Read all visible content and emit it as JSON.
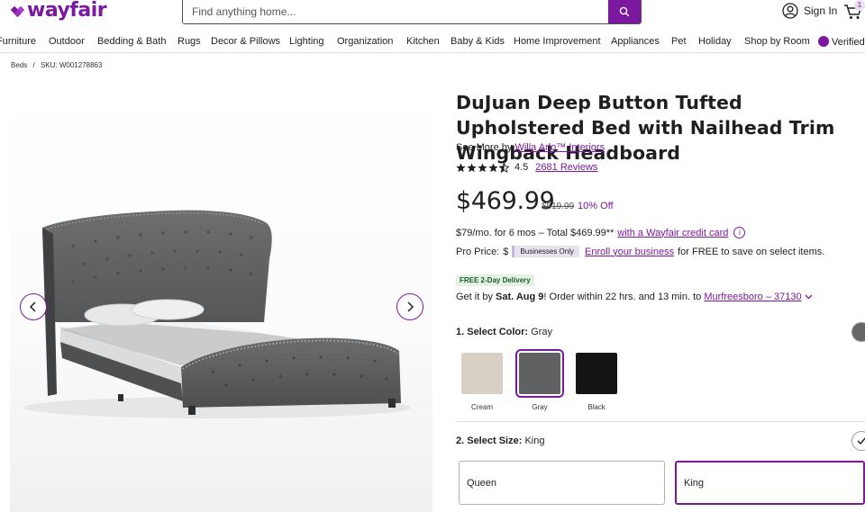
{
  "brand": {
    "name": "wayfair",
    "color": "#7b189f"
  },
  "search": {
    "placeholder": "Find anything home..."
  },
  "account": {
    "signin_label": "Sign In",
    "cart_count": "1"
  },
  "nav": [
    "Furniture",
    "Outdoor",
    "Bedding & Bath",
    "Rugs",
    "Decor & Pillows",
    "Lighting",
    "Organization",
    "Kitchen",
    "Baby & Kids",
    "Home Improvement",
    "Appliances",
    "Pet",
    "Holiday",
    "Shop by Room",
    "Verified"
  ],
  "breadcrumb": {
    "category": "Beds",
    "separator": "/",
    "sku": "SKU: W001278863"
  },
  "product": {
    "title": "DuJuan Deep Button Tufted Upholstered Bed with Nailhead Trim Wingback Headboard",
    "see_more_prefix": "See More by",
    "brand": "Willa Arlo™ Interiors",
    "rating": "4.5",
    "stars": 4.5,
    "reviews": "2681 Reviews",
    "price": "$469.99",
    "old_price": "$519.99",
    "discount": "10% Off",
    "finance_text": "$79/mo. for 6 mos – Total $469.99**",
    "finance_link": "with a Wayfair credit card",
    "pro_label": "Pro Price:",
    "pro_price": "$",
    "business_tag": "Businesses Only",
    "enroll_link": "Enroll your business",
    "enroll_suffix": "for FREE to save on select items.",
    "delivery_tag": "FREE 2-Day Delivery",
    "getit_prefix": "Get it by",
    "getit_date": "Sat. Aug 9",
    "getit_middle": "! Order within 22 hrs. and 13 min. to",
    "getit_location": "Murfreesboro – 37130"
  },
  "color_select": {
    "label": "1. Select Color:",
    "value": "Gray",
    "options": [
      {
        "name": "Cream",
        "color": "#d8d0c4"
      },
      {
        "name": "Gray",
        "color": "#5f6163"
      },
      {
        "name": "Black",
        "color": "#141414"
      }
    ]
  },
  "size_select": {
    "label": "2. Select Size:",
    "value": "King",
    "options": [
      "Queen",
      "King"
    ]
  },
  "icons": {
    "search": "search-icon",
    "account": "account-icon",
    "cart": "cart-icon",
    "prev": "chevron-left-icon",
    "next": "chevron-right-icon",
    "info": "info-icon",
    "location_dropdown": "chevron-down-icon"
  }
}
